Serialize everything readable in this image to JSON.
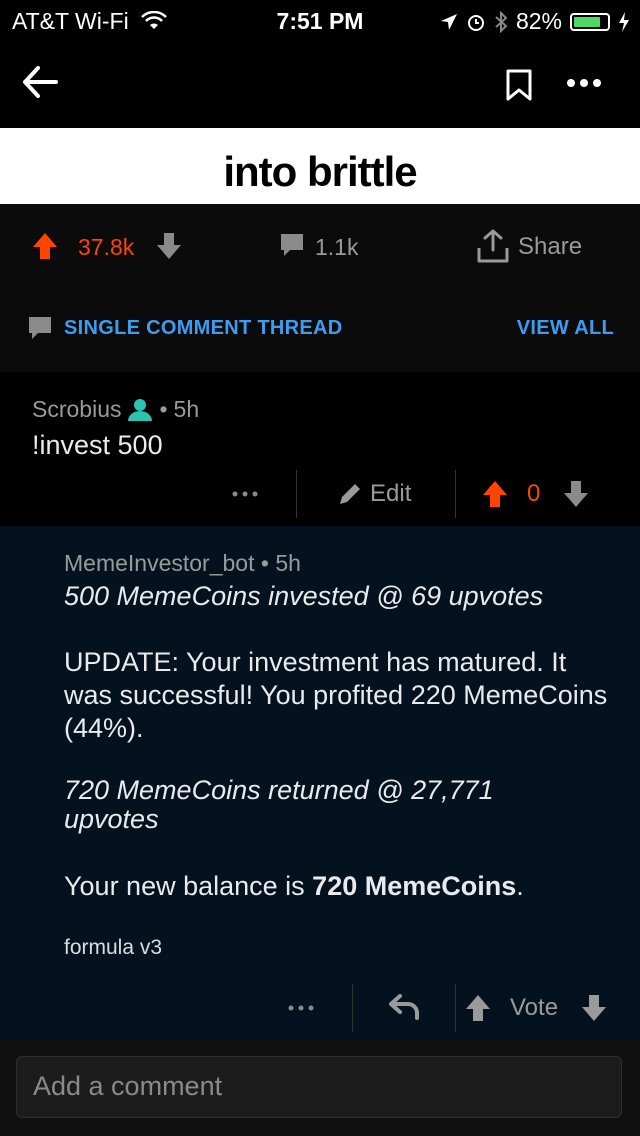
{
  "status": {
    "carrier": "AT&T Wi-Fi",
    "time": "7:51 PM",
    "battery": "82%",
    "battery_level": 0.82
  },
  "post": {
    "title_line": "into brittle",
    "upvotes": "37.8k",
    "comments": "1.1k",
    "share_label": "Share"
  },
  "thread": {
    "label": "SINGLE COMMENT THREAD",
    "view_all": "VIEW ALL"
  },
  "comment1": {
    "author": "Scrobius",
    "age": "5h",
    "body": "!invest 500",
    "edit_label": "Edit",
    "score": "0"
  },
  "comment2": {
    "author": "MemeInvestor_bot",
    "age": "5h",
    "line1": "500 MemeCoins invested @ 69 upvotes",
    "update": "UPDATE: Your investment has matured. It was successful! You profited 220 MemeCoins (44%).",
    "returned": "720 MemeCoins returned @ 27,771 upvotes",
    "balance_prefix": "Your new balance is ",
    "balance_value": "720 MemeCoins",
    "balance_suffix": ".",
    "formula": "formula v3",
    "vote_label": "Vote"
  },
  "composer": {
    "placeholder": "Add a comment"
  },
  "colors": {
    "upvote": "#ff4500",
    "link_blue": "#3d9cf0",
    "mod_teal": "#2cc4b0"
  }
}
